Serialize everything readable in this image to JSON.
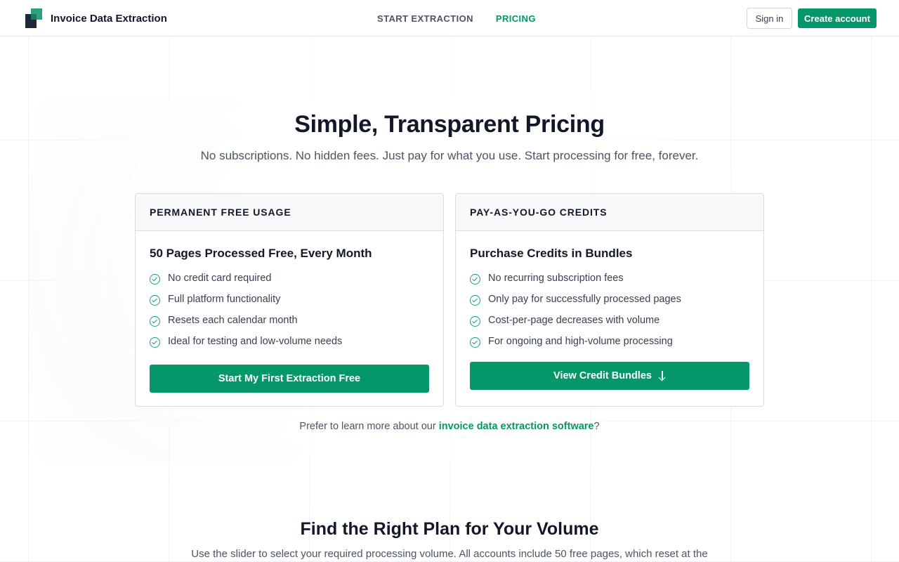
{
  "header": {
    "brand_name": "Invoice Data Extraction",
    "nav": [
      {
        "label": "START EXTRACTION",
        "active": false
      },
      {
        "label": "PRICING",
        "active": true
      }
    ],
    "sign_in": "Sign in",
    "create_account": "Create account"
  },
  "hero": {
    "title": "Simple, Transparent Pricing",
    "subtitle": "No subscriptions. No hidden fees. Just pay for what you use. Start processing for free, forever."
  },
  "cards": [
    {
      "header": "PERMANENT FREE USAGE",
      "title": "50 Pages Processed Free, Every Month",
      "features": [
        "No credit card required",
        "Full platform functionality",
        "Resets each calendar month",
        "Ideal for testing and low-volume needs"
      ],
      "button": "Start My First Extraction Free"
    },
    {
      "header": "PAY-AS-YOU-GO CREDITS",
      "title": "Purchase Credits in Bundles",
      "features": [
        "No recurring subscription fees",
        "Only pay for successfully processed pages",
        "Cost-per-page decreases with volume",
        "For ongoing and high-volume processing"
      ],
      "button": "View Credit Bundles",
      "button_icon": "arrow-down-icon"
    }
  ],
  "learn_more": {
    "prefix": "Prefer to learn more about our ",
    "link": "invoice data extraction software",
    "suffix": "?"
  },
  "plans": {
    "title": "Find the Right Plan for Your Volume",
    "subtitle": "Use the slider to select your required processing volume. All accounts include 50 free pages, which reset at the"
  },
  "colors": {
    "accent": "#059669",
    "check": "#10a37f",
    "text_dark": "#111827",
    "text_muted": "#4b5563"
  }
}
